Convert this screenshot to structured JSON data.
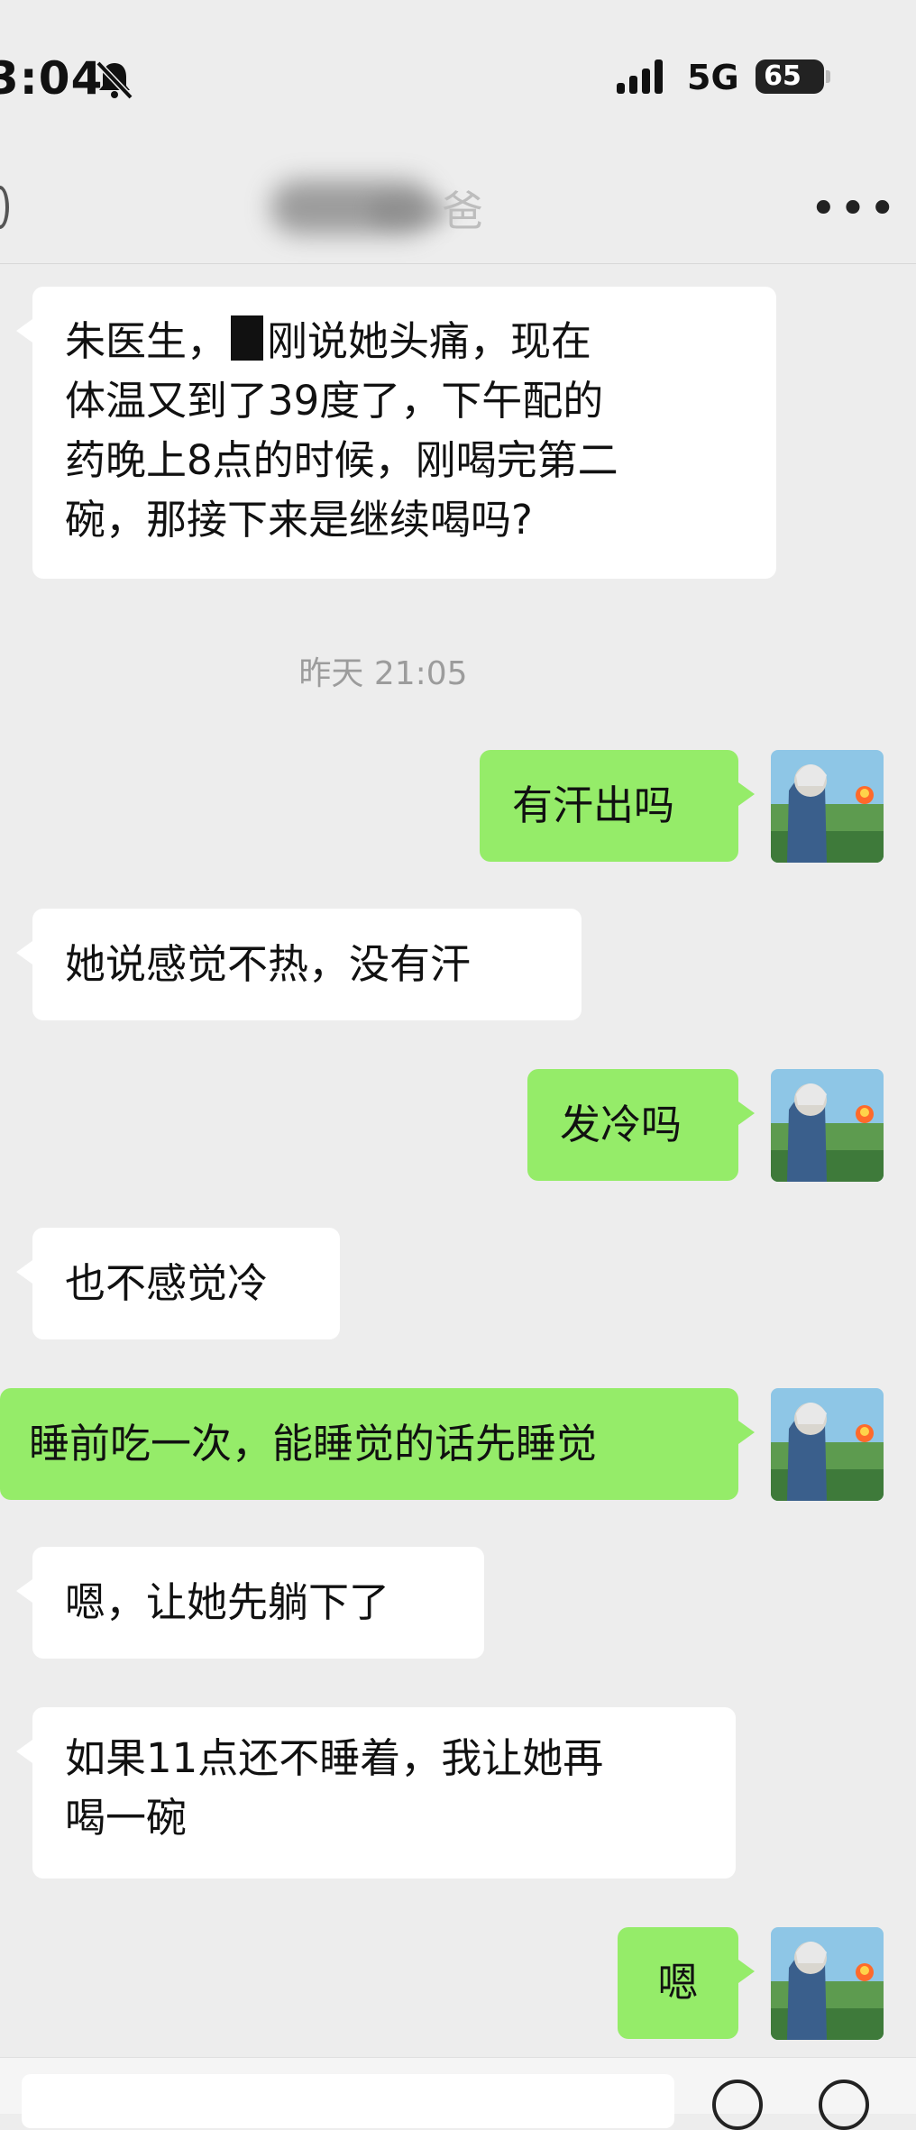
{
  "status_bar": {
    "time": "3:04",
    "network": "5G",
    "battery": "65"
  },
  "header": {
    "contact_name_fragment": "爸",
    "more_label": "•••"
  },
  "messages": [
    {
      "dir": "in",
      "line1_a": "朱医生，",
      "line1_b": "刚说她头痛，现在",
      "line2": "体温又到了39度了，下午配的",
      "line3": "药晚上8点的时候，刚喝完第二",
      "line4": "碗，那接下来是继续喝吗?"
    },
    {
      "dir": "out",
      "text": "有汗出吗"
    },
    {
      "dir": "in",
      "text": "她说感觉不热，没有汗"
    },
    {
      "dir": "out",
      "text": "发冷吗"
    },
    {
      "dir": "in",
      "text": "也不感觉冷"
    },
    {
      "dir": "out",
      "text": "睡前吃一次，能睡觉的话先睡觉"
    },
    {
      "dir": "in",
      "text": "嗯，让她先躺下了"
    },
    {
      "dir": "in",
      "line1": "如果11点还不睡着，我让她再",
      "line2": "喝一碗"
    },
    {
      "dir": "out",
      "text": "嗯"
    }
  ],
  "timestamp": "昨天 21:05",
  "colors": {
    "outgoing_bubble": "#95ec69",
    "incoming_bubble": "#ffffff",
    "background": "#ededed"
  },
  "icons": [
    "bell-muted-icon",
    "signal-icon",
    "battery-icon",
    "more-icon",
    "avatar-image"
  ]
}
